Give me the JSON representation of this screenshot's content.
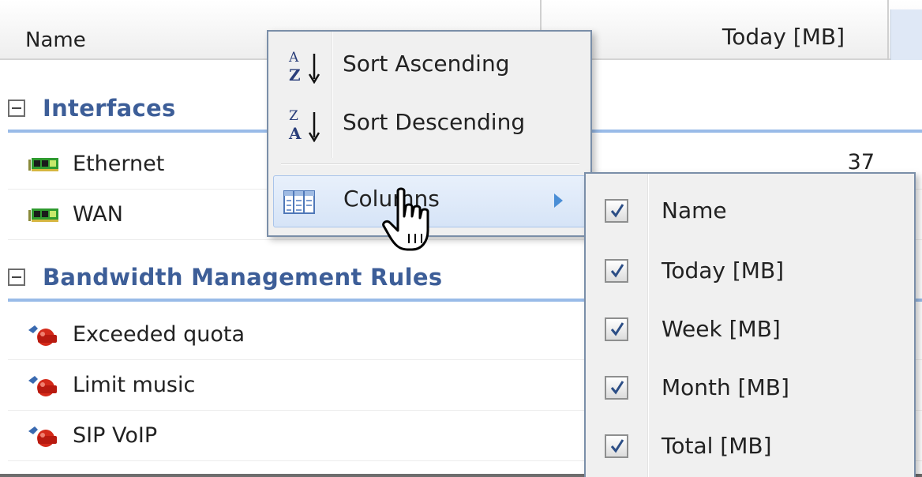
{
  "grid": {
    "columns": {
      "name": "Name",
      "today": "Today [MB]"
    },
    "groups": [
      {
        "label": "Interfaces",
        "rows": [
          {
            "label": "Ethernet",
            "icon": "network-card-icon",
            "today": "37"
          },
          {
            "label": "WAN",
            "icon": "network-card-icon",
            "today": ""
          }
        ]
      },
      {
        "label": "Bandwidth Management Rules",
        "rows": [
          {
            "label": "Exceeded quota",
            "icon": "bandwidth-rule-icon",
            "today": ""
          },
          {
            "label": "Limit music",
            "icon": "bandwidth-rule-icon",
            "today": ""
          },
          {
            "label": "SIP VoIP",
            "icon": "bandwidth-rule-icon",
            "today": ""
          }
        ]
      }
    ]
  },
  "context_menu": {
    "items": [
      {
        "label": "Sort Ascending",
        "icon": "sort-ascending-icon"
      },
      {
        "label": "Sort Descending",
        "icon": "sort-descending-icon"
      },
      {
        "label": "Columns",
        "icon": "columns-icon",
        "active": true
      }
    ]
  },
  "columns_submenu": {
    "items": [
      {
        "label": "Name",
        "checked": true
      },
      {
        "label": "Today [MB]",
        "checked": true
      },
      {
        "label": "Week [MB]",
        "checked": true
      },
      {
        "label": "Month [MB]",
        "checked": true
      },
      {
        "label": "Total [MB]",
        "checked": true
      }
    ]
  },
  "colors": {
    "group_text": "#3d5e98",
    "group_divider": "#99bbe8",
    "menu_highlight": "#d6e4f7",
    "submenu_arrow": "#4a8ed6"
  }
}
